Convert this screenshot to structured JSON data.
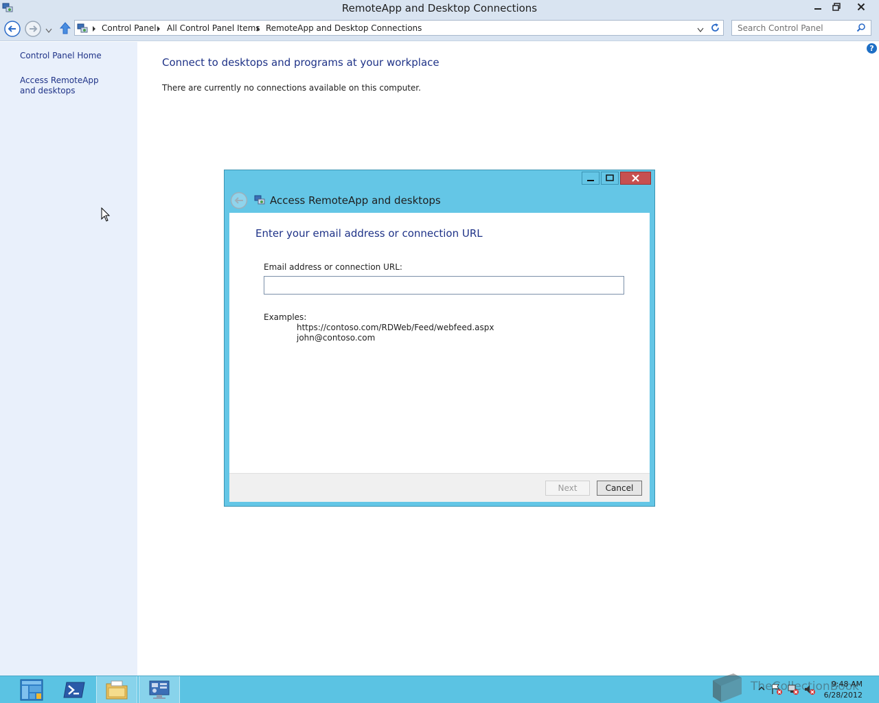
{
  "window": {
    "title": "RemoteApp and Desktop Connections"
  },
  "address_bar": {
    "breadcrumbs": [
      "Control Panel",
      "All Control Panel Items",
      "RemoteApp and Desktop Connections"
    ],
    "search_placeholder": "Search Control Panel"
  },
  "sidebar": {
    "items": [
      {
        "label": "Control Panel Home"
      },
      {
        "label": "Access RemoteApp and desktops"
      }
    ]
  },
  "main": {
    "heading": "Connect to desktops and programs at your workplace",
    "status_text": "There are currently no connections available on this computer.",
    "help_glyph": "?"
  },
  "dialog": {
    "title": "Access RemoteApp and desktops",
    "heading": "Enter your email address or connection URL",
    "field_label": "Email address or connection URL:",
    "field_value": "",
    "examples_label": "Examples:",
    "examples": [
      "https://contoso.com/RDWeb/Feed/webfeed.aspx",
      "john@contoso.com"
    ],
    "next_label": "Next",
    "cancel_label": "Cancel"
  },
  "taskbar": {
    "items": [
      "server-manager",
      "powershell",
      "file-explorer",
      "control-panel"
    ],
    "active_item": "control-panel",
    "time": "9:48 AM",
    "date": "6/28/2012",
    "watermark": "TheCollectionBook"
  },
  "colors": {
    "accent_blue": "#1e3287",
    "dialog_frame": "#64c6e6",
    "taskbar": "#5bc3e3",
    "sidebar": "#e9f0fb",
    "close_button": "#c75050"
  }
}
